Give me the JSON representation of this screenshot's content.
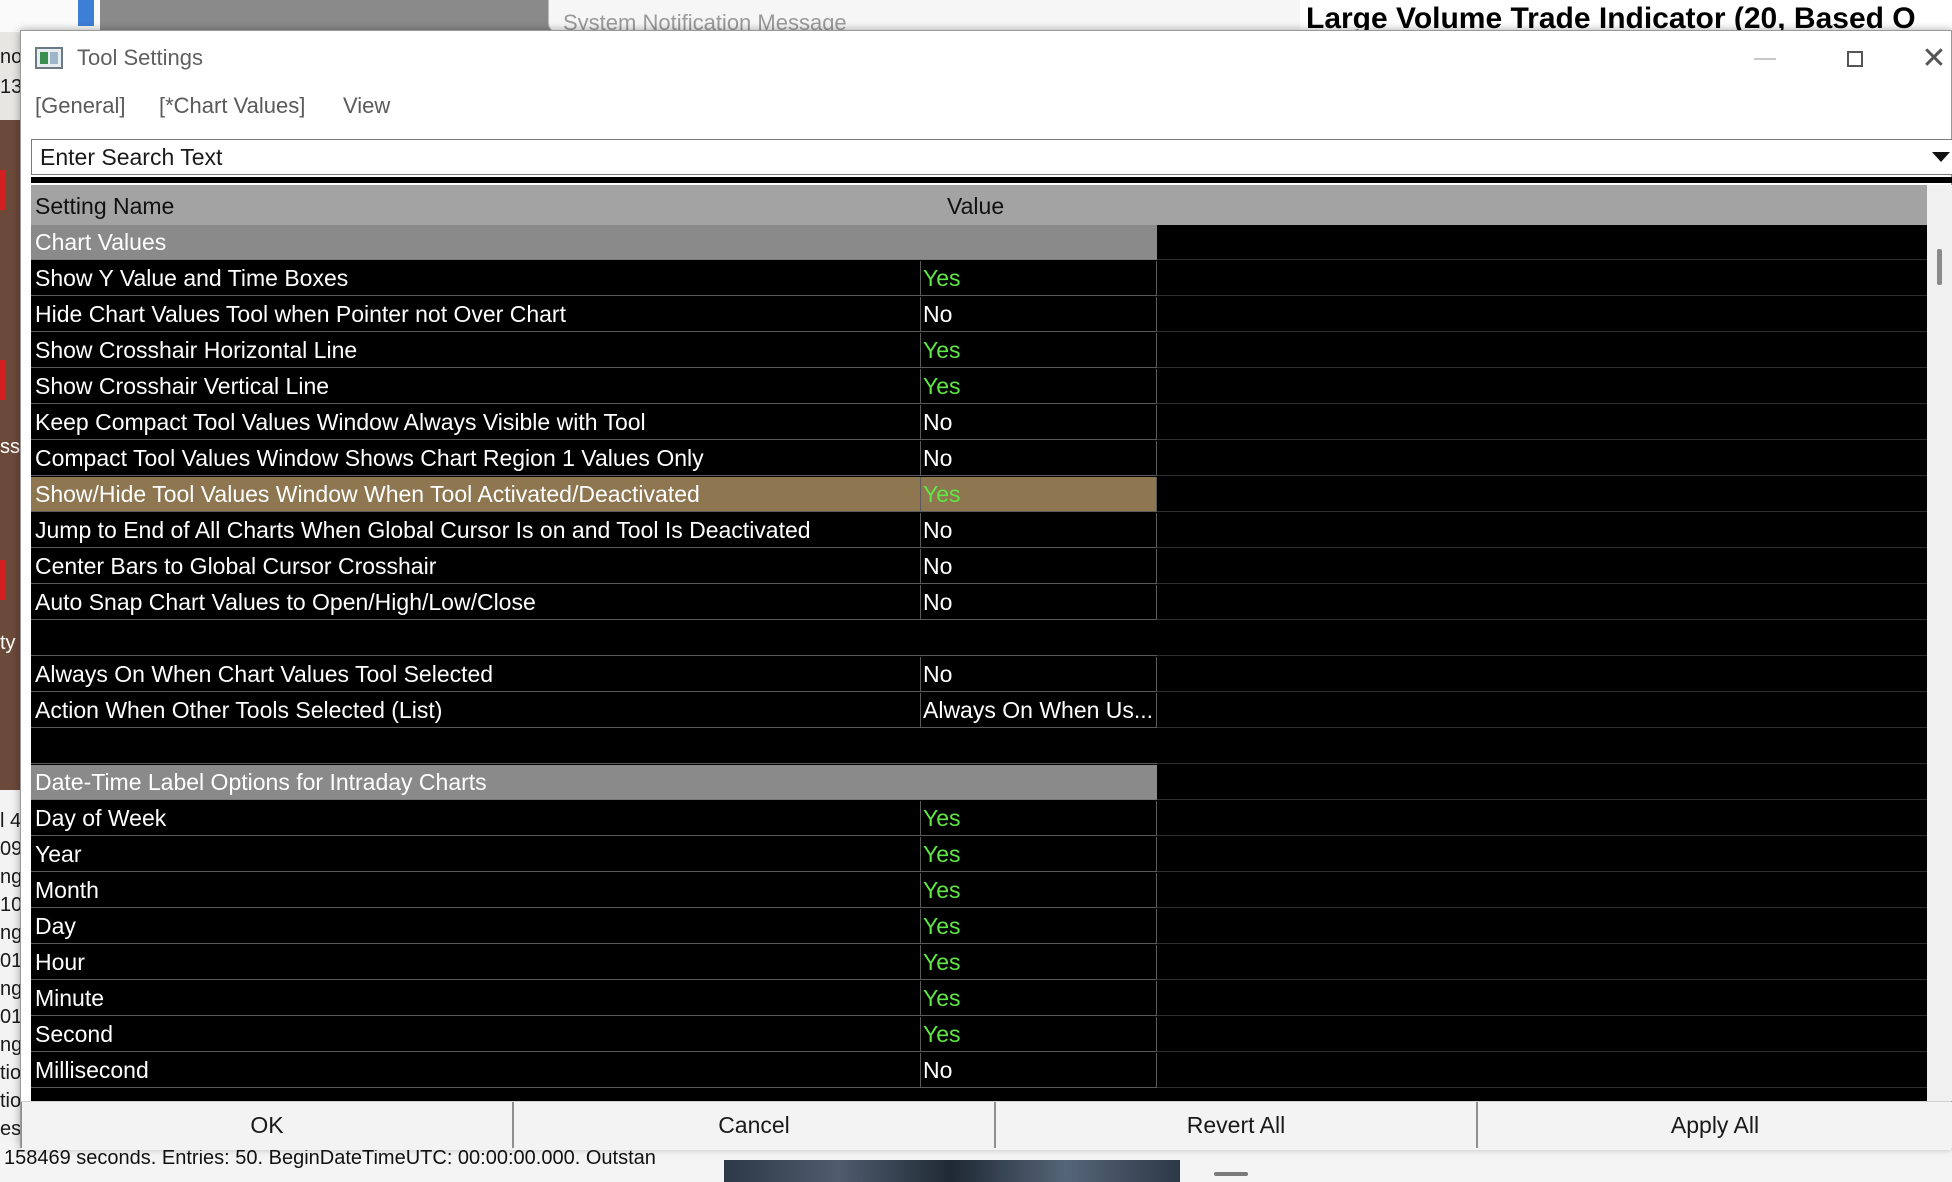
{
  "background": {
    "notification_title": "System Notification Message",
    "indicator_title": "Large Volume Trade Indicator (20, Based O",
    "status_message": "158469 seconds. Entries: 50. BeginDateTimeUTC: 00:00:00.000. Outstan",
    "left_fragments": [
      "no",
      "13",
      "ss",
      "ty",
      "l 4",
      "09",
      "ng",
      "10",
      "ng",
      "01",
      "ng",
      "01",
      "ng",
      "tio",
      "tio",
      "est"
    ]
  },
  "window": {
    "title": "Tool Settings"
  },
  "menu": {
    "general": "[General]",
    "chart_values": "[*Chart Values]",
    "view": "View"
  },
  "search": {
    "placeholder": "Enter Search Text"
  },
  "grid": {
    "col_name": "Setting Name",
    "col_value": "Value",
    "rows": [
      {
        "type": "section",
        "name": "Chart Values"
      },
      {
        "type": "setting",
        "name": "Show Y Value and Time Boxes",
        "value": "Yes"
      },
      {
        "type": "setting",
        "name": "Hide Chart Values Tool when Pointer not Over Chart",
        "value": "No"
      },
      {
        "type": "setting",
        "name": "Show Crosshair Horizontal Line",
        "value": "Yes"
      },
      {
        "type": "setting",
        "name": "Show Crosshair Vertical Line",
        "value": "Yes"
      },
      {
        "type": "setting",
        "name": "Keep Compact Tool Values Window Always Visible with Tool",
        "value": "No"
      },
      {
        "type": "setting",
        "name": "Compact Tool Values Window Shows Chart Region 1 Values Only",
        "value": "No"
      },
      {
        "type": "setting",
        "name": "Show/Hide Tool Values Window When Tool Activated/Deactivated",
        "value": "Yes",
        "selected": true
      },
      {
        "type": "setting",
        "name": "Jump to End of All Charts When Global Cursor Is on and Tool Is Deactivated",
        "value": "No"
      },
      {
        "type": "setting",
        "name": "Center Bars to Global Cursor Crosshair",
        "value": "No"
      },
      {
        "type": "setting",
        "name": "Auto Snap Chart Values to Open/High/Low/Close",
        "value": "No"
      },
      {
        "type": "blank",
        "name": ""
      },
      {
        "type": "setting",
        "name": "Always On When Chart Values Tool Selected",
        "value": "No"
      },
      {
        "type": "setting",
        "name": "Action When Other Tools Selected (List)",
        "value": "Always On When Us..."
      },
      {
        "type": "blank",
        "name": ""
      },
      {
        "type": "section",
        "name": "Date-Time Label Options for Intraday Charts"
      },
      {
        "type": "setting",
        "name": "Day of Week",
        "value": "Yes"
      },
      {
        "type": "setting",
        "name": "Year",
        "value": "Yes"
      },
      {
        "type": "setting",
        "name": "Month",
        "value": "Yes"
      },
      {
        "type": "setting",
        "name": "Day",
        "value": "Yes"
      },
      {
        "type": "setting",
        "name": "Hour",
        "value": "Yes"
      },
      {
        "type": "setting",
        "name": "Minute",
        "value": "Yes"
      },
      {
        "type": "setting",
        "name": "Second",
        "value": "Yes"
      },
      {
        "type": "setting",
        "name": "Millisecond",
        "value": "No"
      }
    ]
  },
  "footer": {
    "ok": "OK",
    "cancel": "Cancel",
    "revert_all": "Revert All",
    "apply_all": "Apply All"
  },
  "colors": {
    "yes_value": "#5ee843",
    "selected_row": "#8d7650",
    "section_row": "#8a8a8a",
    "grid_background": "#000000"
  }
}
